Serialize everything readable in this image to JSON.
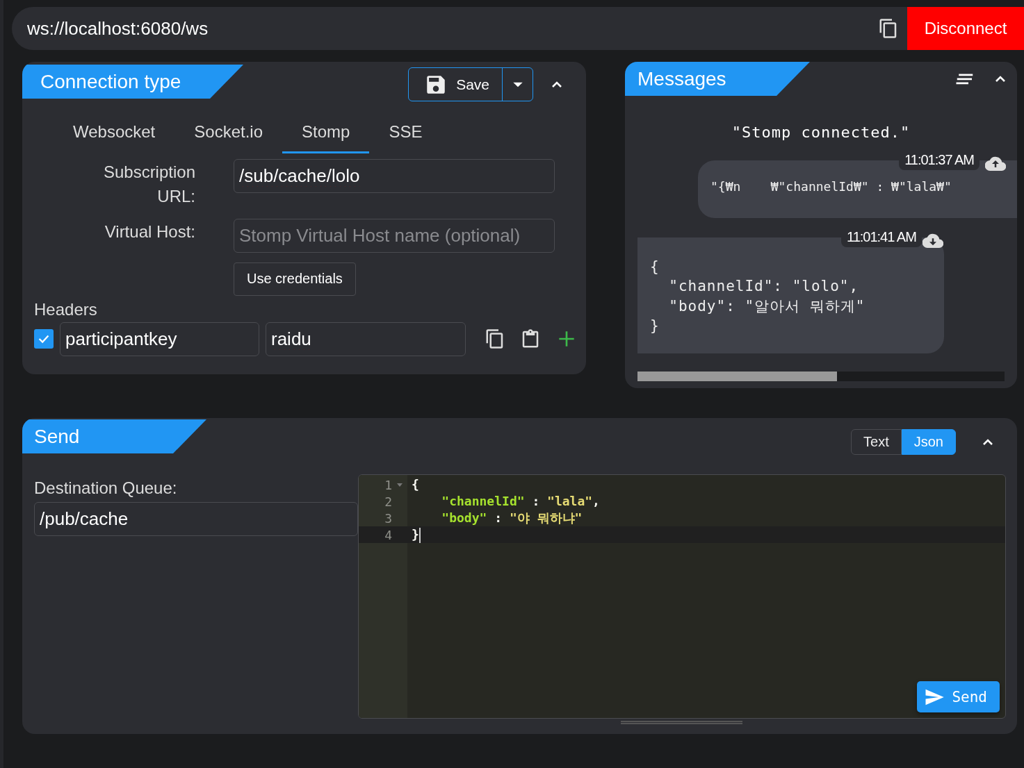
{
  "address": {
    "value": "ws://localhost:6080/ws"
  },
  "disconnect_button": "Disconnect",
  "connection": {
    "title": "Connection type",
    "save_button": "Save",
    "tabs": [
      {
        "label": "Websocket",
        "selected": false
      },
      {
        "label": "Socket.io",
        "selected": false
      },
      {
        "label": "Stomp",
        "selected": true
      },
      {
        "label": "SSE",
        "selected": false
      }
    ],
    "fields": [
      {
        "label": "Subscription URL:",
        "value": "/sub/cache/lolo"
      },
      {
        "label": "Virtual Host:",
        "placeholder": "Stomp Virtual Host name (optional)"
      }
    ],
    "credentials_button": "Use credentials",
    "headers_label": "Headers",
    "headers": [
      {
        "checked": true,
        "key": "participantkey",
        "value": "raidu"
      }
    ]
  },
  "messages": {
    "title": "Messages",
    "items": [
      {
        "kind": "info",
        "text": "\"Stomp connected.\""
      },
      {
        "kind": "sent",
        "time": "11:01:37 AM",
        "text": "\"{₩n    ₩\"channelId₩\" : ₩\"lala₩\""
      },
      {
        "kind": "received",
        "time": "11:01:41 AM",
        "text": "{\n  \"channelId\": \"lolo\",\n  \"body\": \"알아서 뭐하게\"\n}"
      }
    ]
  },
  "send": {
    "title": "Send",
    "formats": [
      {
        "label": "Text",
        "selected": false
      },
      {
        "label": "Json",
        "selected": true
      }
    ],
    "destination_label": "Destination Queue:",
    "destination": "/pub/cache",
    "editor": {
      "lines": [
        {
          "number": "1",
          "foldable": true,
          "active": false,
          "tokens": [
            {
              "kind": "punct",
              "text": "{"
            }
          ]
        },
        {
          "number": "2",
          "foldable": false,
          "active": false,
          "tokens": [
            {
              "kind": "key",
              "text": "    \"channelId\""
            },
            {
              "kind": "punct",
              "text": " : "
            },
            {
              "kind": "string",
              "text": "\"lala\""
            },
            {
              "kind": "punct",
              "text": ","
            }
          ]
        },
        {
          "number": "3",
          "foldable": false,
          "active": false,
          "tokens": [
            {
              "kind": "key",
              "text": "    \"body\""
            },
            {
              "kind": "punct",
              "text": " : "
            },
            {
              "kind": "string",
              "text": "\"야 뭐하냐\""
            }
          ]
        },
        {
          "number": "4",
          "foldable": false,
          "active": true,
          "tokens": [
            {
              "kind": "punct",
              "text": "}"
            }
          ]
        }
      ]
    },
    "send_button": "Send"
  }
}
